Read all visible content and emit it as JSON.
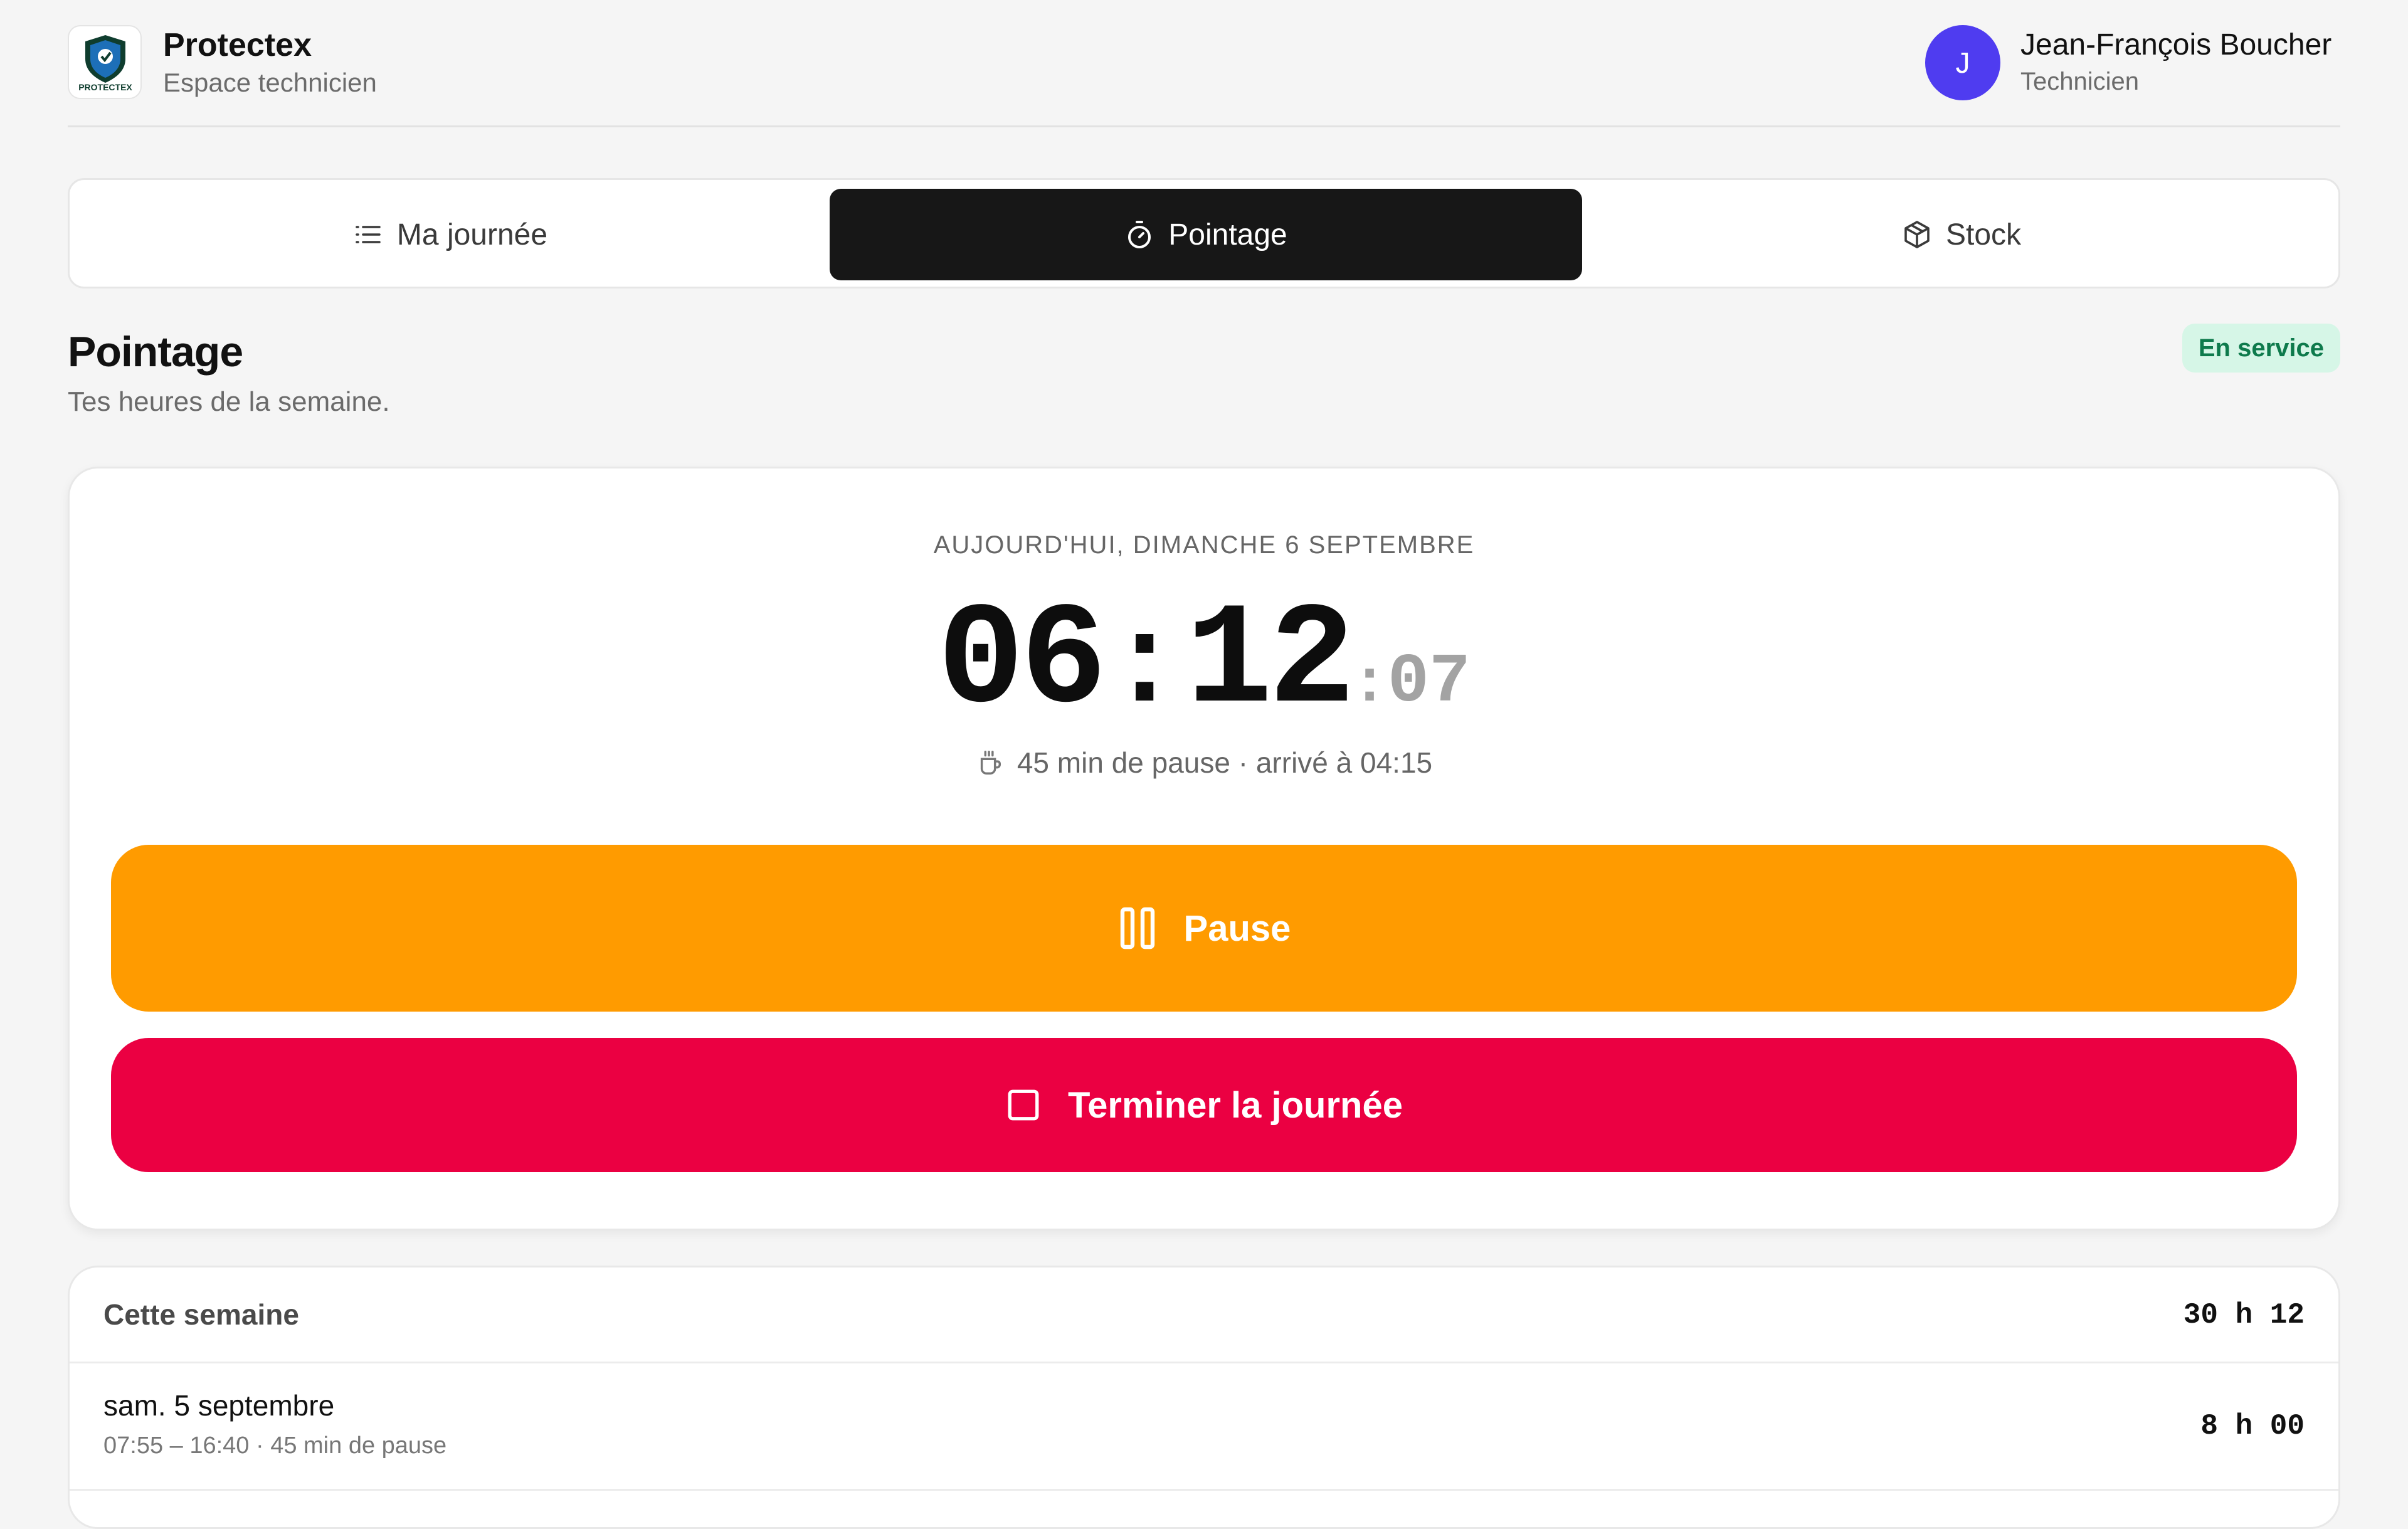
{
  "header": {
    "brand_name": "Protectex",
    "brand_subtitle": "Espace technicien",
    "logo_text": "PROTECTEX",
    "user_initial": "J",
    "user_name": "Jean-François Boucher",
    "user_role": "Technicien",
    "avatar_color": "#4f3cf0"
  },
  "tabs": [
    {
      "label": "Ma journée",
      "icon": "list-icon",
      "active": false
    },
    {
      "label": "Pointage",
      "icon": "stopwatch-icon",
      "active": true
    },
    {
      "label": "Stock",
      "icon": "package-icon",
      "active": false
    }
  ],
  "page": {
    "title": "Pointage",
    "subtitle": "Tes heures de la semaine.",
    "status": "En service",
    "status_color": "#0e7a4c"
  },
  "clock": {
    "date_label": "AUJOURD'HUI, DIMANCHE 6 SEPTEMBRE",
    "hours": "06",
    "minutes": "12",
    "seconds": "07",
    "pause_info": "45 min de pause · arrivé à 04:15",
    "pause_icon": "coffee-icon"
  },
  "actions": {
    "pause_label": "Pause",
    "pause_color": "#ff9b00",
    "end_label": "Terminer la journée",
    "end_color": "#eb0042"
  },
  "week": {
    "title": "Cette semaine",
    "total": "30 h 12",
    "days": [
      {
        "name": "sam. 5 septembre",
        "detail": "07:55 – 16:40 · 45 min de pause",
        "total": "8 h 00"
      }
    ]
  }
}
